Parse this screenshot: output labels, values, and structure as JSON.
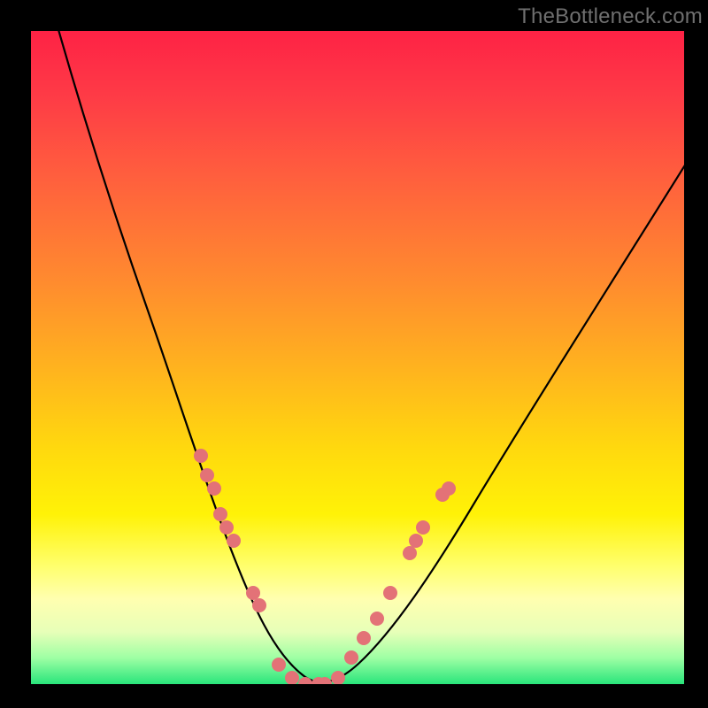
{
  "watermark": "TheBottleneck.com",
  "colors": {
    "frame": "#000000",
    "curve": "#000000",
    "dots": "#e37277",
    "gradient_top": "#fe2245",
    "gradient_mid": "#ffd90e",
    "gradient_bottom": "#29e57b"
  },
  "chart_data": {
    "type": "line",
    "title": "",
    "xlabel": "",
    "ylabel": "",
    "xlim": [
      0,
      100
    ],
    "ylim": [
      0,
      100
    ],
    "grid": false,
    "note": "Axes are unlabeled; x/y are normalized 0–100. y = bottleneck percentage (0 best, 100 worst). Curve is V-shaped with minimum near x≈42.",
    "series": [
      {
        "name": "bottleneck-curve",
        "x": [
          4,
          6,
          10,
          14,
          18,
          22,
          26,
          30,
          34,
          38,
          40,
          42,
          46,
          50,
          54,
          58,
          62,
          66,
          72,
          80,
          90,
          100
        ],
        "y": [
          100,
          92,
          78,
          65,
          54,
          44,
          35,
          26,
          18,
          9,
          3,
          0,
          2,
          7,
          12,
          18,
          24,
          30,
          39,
          51,
          66,
          80
        ]
      }
    ],
    "scatter": {
      "name": "sample-dots",
      "points": [
        {
          "x": 26,
          "y": 35
        },
        {
          "x": 27,
          "y": 32
        },
        {
          "x": 28,
          "y": 30
        },
        {
          "x": 29,
          "y": 26
        },
        {
          "x": 30,
          "y": 24
        },
        {
          "x": 31,
          "y": 22
        },
        {
          "x": 34,
          "y": 14
        },
        {
          "x": 35,
          "y": 12
        },
        {
          "x": 38,
          "y": 3
        },
        {
          "x": 40,
          "y": 1
        },
        {
          "x": 42,
          "y": 0
        },
        {
          "x": 44,
          "y": 0
        },
        {
          "x": 45,
          "y": 0
        },
        {
          "x": 47,
          "y": 1
        },
        {
          "x": 49,
          "y": 4
        },
        {
          "x": 51,
          "y": 7
        },
        {
          "x": 53,
          "y": 10
        },
        {
          "x": 55,
          "y": 14
        },
        {
          "x": 58,
          "y": 20
        },
        {
          "x": 59,
          "y": 22
        },
        {
          "x": 60,
          "y": 24
        },
        {
          "x": 63,
          "y": 29
        },
        {
          "x": 64,
          "y": 30
        }
      ]
    }
  }
}
